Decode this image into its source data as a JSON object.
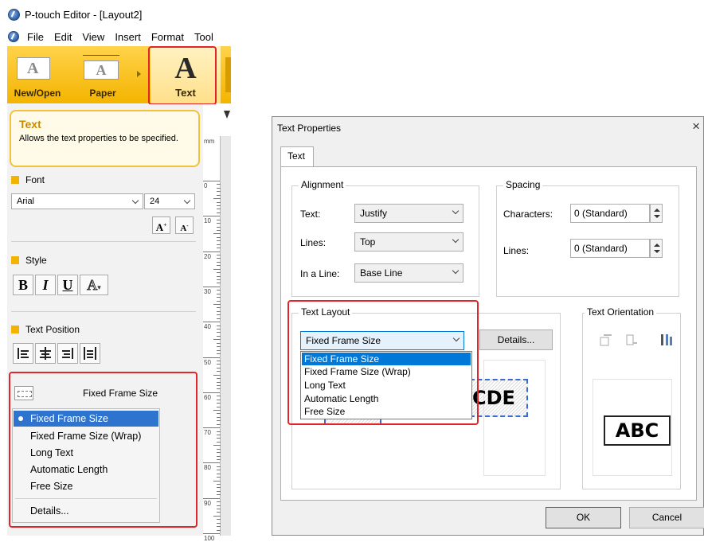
{
  "left": {
    "title": "P-touch Editor - [Layout2]",
    "menu": [
      "File",
      "Edit",
      "View",
      "Insert",
      "Format",
      "Tool"
    ],
    "ribbon": {
      "new_open": "New/Open",
      "paper": "Paper",
      "text": "Text"
    },
    "tooltip": {
      "title": "Text",
      "text": "Allows the text properties to be specified."
    },
    "ruler_unit": "mm",
    "ruler_numbers": [
      "0",
      "10",
      "20",
      "30",
      "40",
      "50",
      "60",
      "70",
      "80",
      "90",
      "100"
    ],
    "font": {
      "header": "Font",
      "name": "Arial",
      "size": "24"
    },
    "style": {
      "header": "Style",
      "bold": "B",
      "italic": "I",
      "underline": "U",
      "outline": "A"
    },
    "text_position": {
      "header": "Text Position"
    },
    "layout": {
      "current": "Fixed Frame Size",
      "options": [
        "Fixed Frame Size",
        "Fixed Frame Size (Wrap)",
        "Long Text",
        "Automatic Length",
        "Free Size"
      ],
      "details": "Details..."
    },
    "icons": [
      "app-icon",
      "text-A-icon",
      "new-open-icon",
      "paper-icon",
      "font-grow-icon",
      "font-shrink-icon",
      "align-left-icon",
      "align-center-icon",
      "align-right-icon",
      "align-justify-icon",
      "fixed-frame-icon"
    ]
  },
  "dialog": {
    "title": "Text Properties",
    "close": "×",
    "tab": "Text",
    "alignment": {
      "caption": "Alignment",
      "text_label": "Text:",
      "text_value": "Justify",
      "lines_label": "Lines:",
      "lines_value": "Top",
      "inline_label": "In a Line:",
      "inline_value": "Base Line"
    },
    "spacing": {
      "caption": "Spacing",
      "characters_label": "Characters:",
      "characters_value": "0 (Standard)",
      "lines_label": "Lines:",
      "lines_value": "0 (Standard)"
    },
    "text_layout": {
      "caption": "Text Layout",
      "value": "Fixed Frame Size",
      "options": [
        "Fixed Frame Size",
        "Fixed Frame Size (Wrap)",
        "Long Text",
        "Automatic Length",
        "Free Size"
      ],
      "details": "Details...",
      "preview_text": "CDE"
    },
    "text_orientation": {
      "caption": "Text Orientation",
      "preview_text": "ABC"
    },
    "ok": "OK",
    "cancel": "Cancel"
  },
  "colors": {
    "highlight_red": "#e0262b",
    "ribbon_yellow": "#f4b400",
    "selection_blue": "#2e74cf"
  }
}
